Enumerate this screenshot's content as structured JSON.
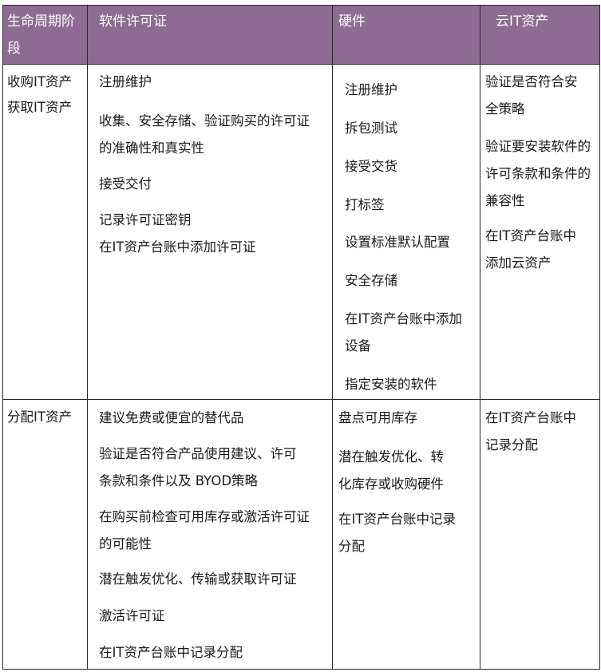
{
  "header": {
    "col1": [
      "生命周期阶",
      "段"
    ],
    "col2": "软件许可证",
    "col3": "硬件",
    "col4": "云IT资产"
  },
  "row1": {
    "stage": [
      "收购IT资产",
      "获取IT资产"
    ],
    "software": [
      "注册维护",
      "收集、安全存储、验证购买的许可证",
      "的准确性和真实性",
      "接受交付",
      "记录许可证密钥",
      "在IT资产台账中添加许可证"
    ],
    "hardware": [
      "注册维护",
      "拆包测试",
      "接受交货",
      "打标签",
      "设置标准默认配置",
      "安全存储",
      "在IT资产台账中添加",
      "设备",
      "指定安装的软件"
    ],
    "cloud": [
      "验证是否符合安",
      "全策略",
      "验证要安装软件的",
      "许可条款和条件的",
      "兼容性",
      "在IT资产台账中",
      "添加云资产"
    ]
  },
  "row2": {
    "stage": [
      "分配IT资产"
    ],
    "software": [
      "建议免费或便宜的替代品",
      "验证是否符合产品使用建议、许可",
      "条款和条件以及 BYOD策略",
      "在购买前检查可用库存或激活许可证",
      "的可能性",
      "潜在触发优化、传输或获取许可证",
      "激活许可证",
      "在IT资产台账中记录分配"
    ],
    "hardware": [
      "盘点可用库存",
      "潜在触发优化、转",
      "化库存或收购硬件",
      "在IT资产台账中记录",
      "分配"
    ],
    "cloud": [
      "在IT资产台账中",
      "记录分配"
    ]
  }
}
